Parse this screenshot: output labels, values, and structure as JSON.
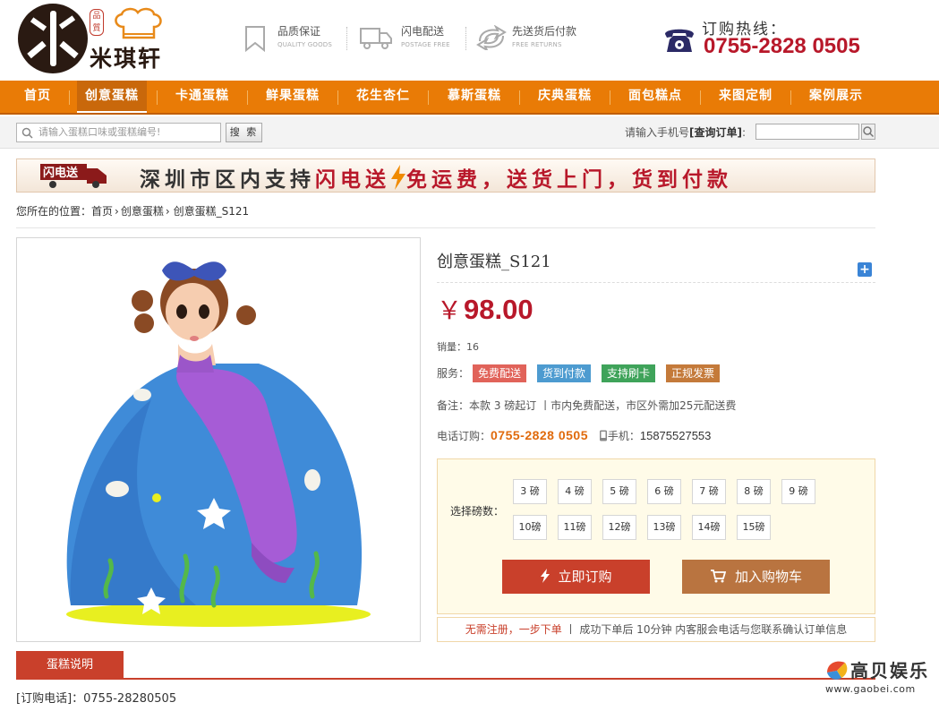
{
  "brand": {
    "name": "米琪轩",
    "seal": "品質"
  },
  "features": [
    {
      "title": "品质保证",
      "subtitle": "QUALITY GOODS",
      "icon": "bookmark-icon"
    },
    {
      "title": "闪电配送",
      "subtitle": "POSTAGE FREE",
      "icon": "truck-icon"
    },
    {
      "title": "先送货后付款",
      "subtitle": "FREE RETURNS",
      "icon": "return-icon"
    }
  ],
  "hotline": {
    "label": "订购热线：",
    "number": "0755-2828 0505",
    "icon": "telephone-icon"
  },
  "nav": [
    "首页",
    "创意蛋糕",
    "卡通蛋糕",
    "鲜果蛋糕",
    "花生杏仁",
    "慕斯蛋糕",
    "庆典蛋糕",
    "面包糕点",
    "来图定制",
    "案例展示"
  ],
  "nav_active": "创意蛋糕",
  "search": {
    "placeholder": "请输入蛋糕口味或蛋糕编号!",
    "button": "搜 索"
  },
  "order_query": {
    "prefix": "请输入手机号",
    "link": "[查询订单]",
    "suffix": ":"
  },
  "banner": {
    "badge": "闪电送",
    "part1": "深圳市区内支持",
    "part2": "闪电送",
    "part3": "免运费，送货上门，货到付款"
  },
  "breadcrumb": {
    "label": "您所在的位置：",
    "items": [
      "首页",
      "创意蛋糕",
      "创意蛋糕_S121"
    ]
  },
  "product": {
    "title": "创意蛋糕_S121",
    "currency": "￥",
    "price": "98.00",
    "sales_label": "销量：",
    "sales": "16",
    "service_label": "服务：",
    "services": [
      {
        "label": "免费配送",
        "color": "#e1635a"
      },
      {
        "label": "货到付款",
        "color": "#4d9bd0"
      },
      {
        "label": "支持刷卡",
        "color": "#3fa35a"
      },
      {
        "label": "正规发票",
        "color": "#c47a3a"
      }
    ],
    "note_label": "备注：",
    "note": "本款 3 磅起订 丨市内免费配送，市区外需加25元配送费",
    "phone_label": "电话订购：",
    "phone": "0755-2828 0505",
    "mobile_label": "手机：",
    "mobile": "15875527553",
    "weight_label": "选择磅数：",
    "weights": [
      "3 磅",
      "4 磅",
      "5 磅",
      "6 磅",
      "7 磅",
      "8 磅",
      "9 磅",
      "10磅",
      "11磅",
      "12磅",
      "13磅",
      "14磅",
      "15磅"
    ],
    "buy_now": "立即订购",
    "add_cart": "加入购物车",
    "tip_red": "无需注册，一步下单",
    "tip_rest": " 丨 成功下单后 10分钟 内客服会电话与您联系确认订单信息"
  },
  "tab": {
    "label": "蛋糕说明"
  },
  "description": "[订购电话]：0755-28280505",
  "watermark": {
    "text": "高贝娱乐",
    "url": "www.gaobei.com"
  }
}
